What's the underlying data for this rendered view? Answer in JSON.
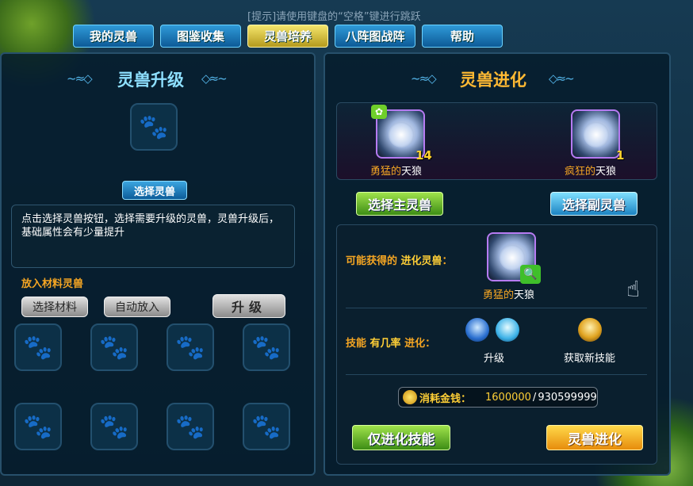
{
  "hint": "[提示]请使用键盘的“空格”键进行跳跃",
  "tabs": [
    "我的灵兽",
    "图鉴收集",
    "灵兽培养",
    "八阵图战阵",
    "帮助"
  ],
  "upgrade": {
    "title": "灵兽升级",
    "select_btn": "选择灵兽",
    "description": "点击选择灵兽按钮，选择需要升级的灵兽，灵兽升级后，基础属性会有少量提升",
    "material_label": "放入材料灵兽",
    "select_material": "选择材料",
    "auto_place": "自动放入",
    "upgrade_btn": "升级"
  },
  "evolution": {
    "title": "灵兽进化",
    "main_beast": {
      "prefix": "勇猛的",
      "name": "天狼",
      "level": "14"
    },
    "sub_beast": {
      "prefix": "疯狂的",
      "name": "天狼",
      "level": "1"
    },
    "select_main": "选择主灵兽",
    "select_sub": "选择副灵兽",
    "possible_label": "可能获得的 ",
    "possible_label_highlight": "进化灵兽",
    "possible_label_colon": "：",
    "result_beast": {
      "prefix": "勇猛的",
      "name": "天狼"
    },
    "skill_label": "技能 ",
    "skill_label_highlight": "有几率",
    "skill_label_suffix": " 进化：",
    "skill_upgrade": "升级",
    "new_skill": "获取新技能",
    "cost_label": "消耗金钱：",
    "cost": "1600000",
    "cost_separator": "/",
    "owned": "930599999",
    "evolve_skill_btn": "仅进化技能",
    "evolve_btn": "灵兽进化"
  },
  "colors": {
    "accent_orange": "#f5a623",
    "active_tab": "#f4e56c",
    "tab_blue": "#2f9ad8",
    "panel_bg": "#0a1f2e"
  }
}
